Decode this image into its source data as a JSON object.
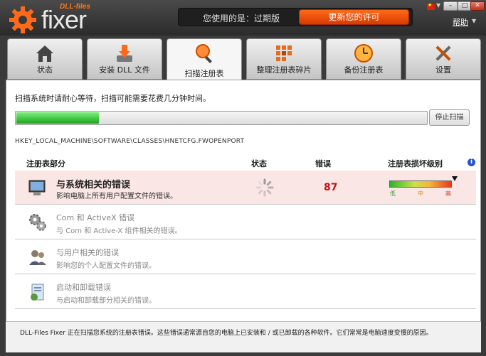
{
  "app": {
    "logo_small": "DLL-files",
    "logo_main": "fixer"
  },
  "header": {
    "status_text": "您使用的是：过期版",
    "buy_button": "更新您的许可",
    "help": "帮助",
    "minimize": "–",
    "maximize": "□",
    "close": "✕"
  },
  "tabs": [
    {
      "label": "状态",
      "icon": "home-icon"
    },
    {
      "label": "安装 DLL 文件",
      "icon": "install-dll-icon"
    },
    {
      "label": "扫描注册表",
      "icon": "magnifier-icon"
    },
    {
      "label": "整理注册表碎片",
      "icon": "defrag-icon"
    },
    {
      "label": "备份注册表",
      "icon": "backup-clock-icon"
    },
    {
      "label": "设置",
      "icon": "tools-icon"
    }
  ],
  "scan": {
    "wait_text": "扫描系统时请耐心等待，扫描可能需要花费几分钟时间。",
    "progress": 0.2,
    "stop_button": "停止扫描",
    "current_path": "HKEY_LOCAL_MACHINE\\SOFTWARE\\CLASSES\\HNETCFG.FWOPENPORT"
  },
  "table": {
    "headers": {
      "section": "注册表部分",
      "status": "状态",
      "errors": "错误",
      "damage": "注册表损坏级别"
    },
    "rows": [
      {
        "title": "与系统相关的错误",
        "desc": "影响电脑上所有用户配置文件的错误。",
        "errors": "87",
        "icon": "system-icon"
      },
      {
        "title": "Com 和 ActiveX 错误",
        "desc": "与 Com 和 Active-X 组件相关的错误。",
        "icon": "gears-icon"
      },
      {
        "title": "与用户相关的错误",
        "desc": "影响您的个人配置文件的错误。",
        "icon": "users-icon"
      },
      {
        "title": "启动和卸载错误",
        "desc": "与启动和卸载部分相关的错误。",
        "icon": "startup-icon"
      }
    ],
    "meter_labels": {
      "low": "低",
      "mid": "中",
      "high": "高"
    }
  },
  "footer": {
    "text": "DLL-Files Fixer 正在扫描您系统的注册表错误。这些错误通常源自您的电脑上已安装和 / 或已卸载的各种软件。它们常常是电脑速度变慢的原因。"
  },
  "colors": {
    "accent": "#ff6a1a",
    "error": "#c81010",
    "progress": "#1ca41c"
  }
}
